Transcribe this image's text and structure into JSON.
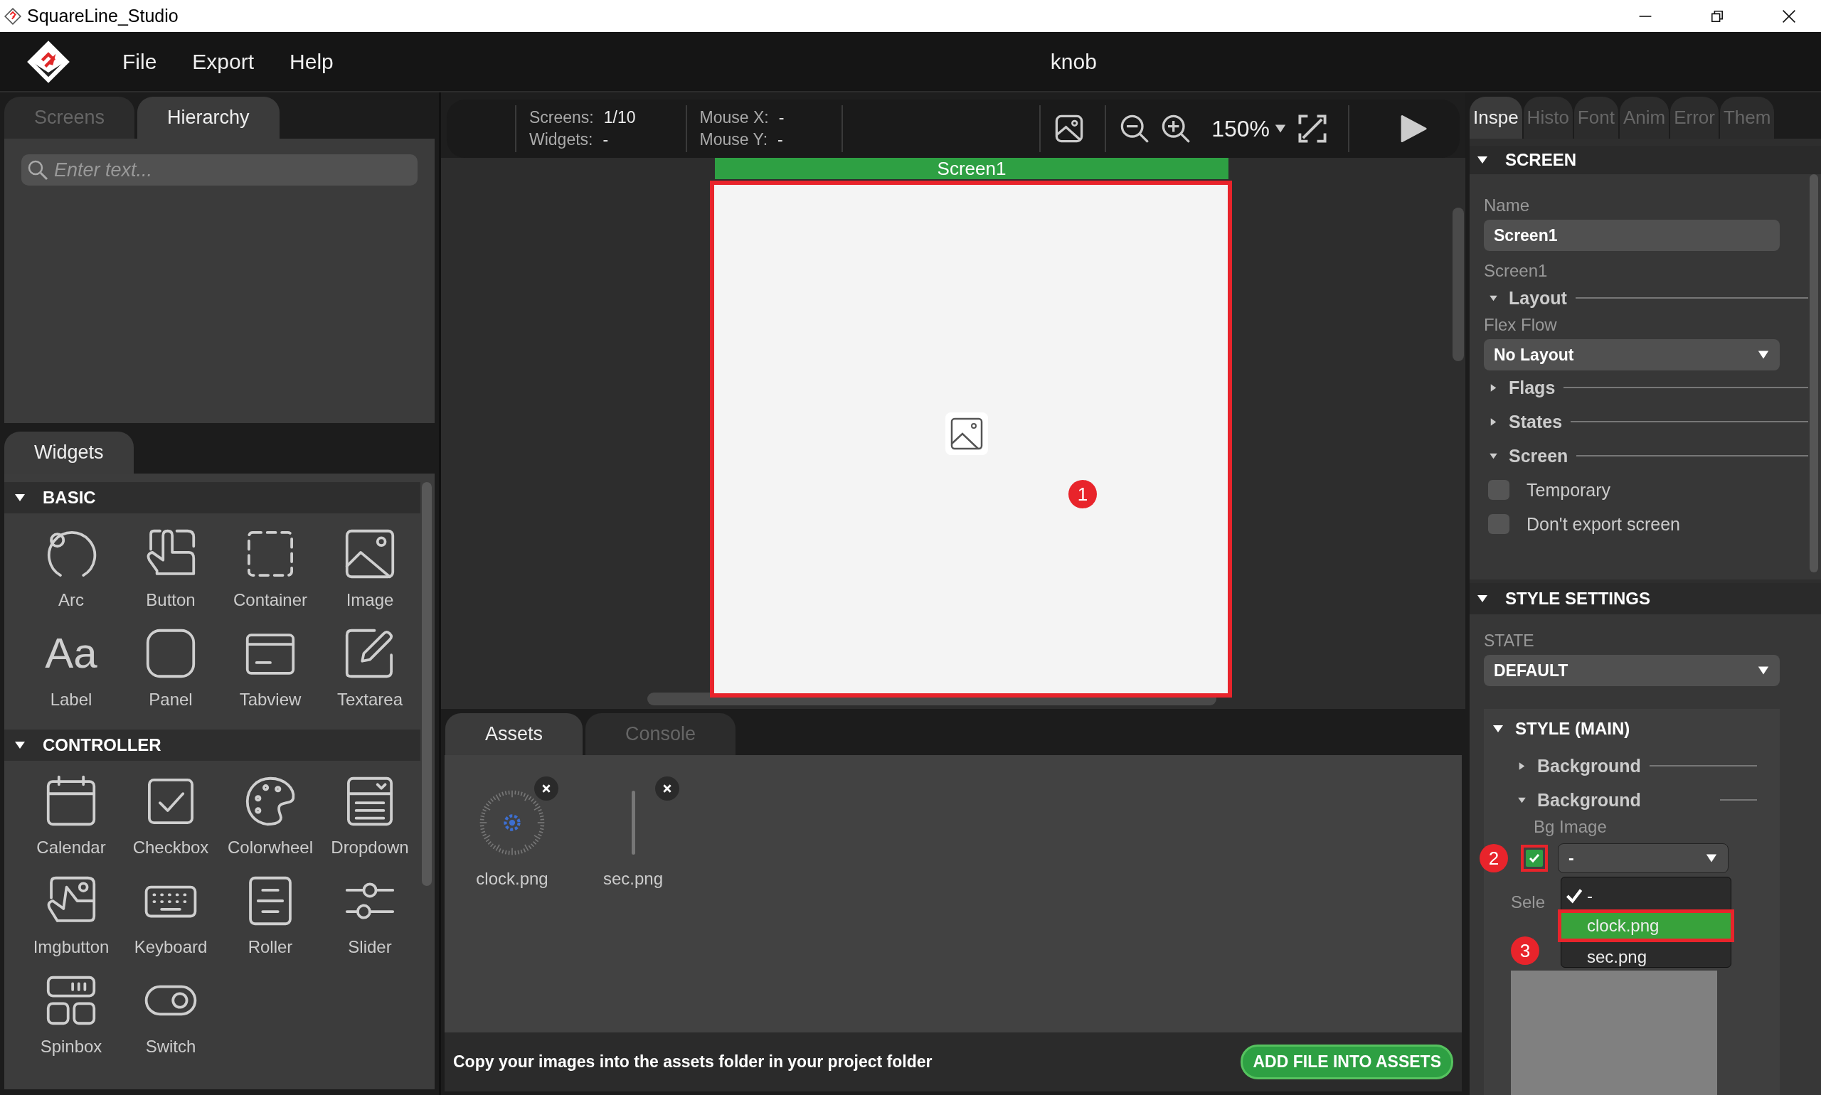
{
  "window": {
    "title": "SquareLine_Studio"
  },
  "menu": [
    "File",
    "Export",
    "Help"
  ],
  "project_title": "knob",
  "left_tabs": [
    {
      "label": "Screens",
      "selected": false
    },
    {
      "label": "Hierarchy",
      "selected": true
    }
  ],
  "hierarchy_search": {
    "placeholder": "Enter text..."
  },
  "widgets_tab": {
    "label": "Widgets",
    "selected": true
  },
  "widget_groups": [
    {
      "title": "BASIC",
      "expanded": true,
      "items": [
        {
          "label": "Arc",
          "kind": "arc"
        },
        {
          "label": "Button",
          "kind": "button"
        },
        {
          "label": "Container",
          "kind": "container"
        },
        {
          "label": "Image",
          "kind": "image"
        },
        {
          "label": "Label",
          "kind": "label",
          "glyph": "Aa"
        },
        {
          "label": "Panel",
          "kind": "panel"
        },
        {
          "label": "Tabview",
          "kind": "tabview"
        },
        {
          "label": "Textarea",
          "kind": "textarea"
        }
      ]
    },
    {
      "title": "CONTROLLER",
      "expanded": true,
      "items": [
        {
          "label": "Calendar",
          "kind": "calendar"
        },
        {
          "label": "Checkbox",
          "kind": "checkbox"
        },
        {
          "label": "Colorwheel",
          "kind": "colorwheel"
        },
        {
          "label": "Dropdown",
          "kind": "dropdown"
        },
        {
          "label": "Imgbutton",
          "kind": "imgbutton"
        },
        {
          "label": "Keyboard",
          "kind": "keyboard"
        },
        {
          "label": "Roller",
          "kind": "roller"
        },
        {
          "label": "Slider",
          "kind": "slider"
        },
        {
          "label": "Spinbox",
          "kind": "spinbox"
        },
        {
          "label": "Switch",
          "kind": "switch"
        }
      ]
    }
  ],
  "toolbar": {
    "screens_label": "Screens:",
    "screens_value": "1/10",
    "widgets_label": "Widgets:",
    "widgets_value": "-",
    "mouse_x_label": "Mouse X:",
    "mouse_x_value": "-",
    "mouse_y_label": "Mouse Y:",
    "mouse_y_value": "-",
    "zoom": "150%"
  },
  "canvas": {
    "screen_title": "Screen1"
  },
  "annotations": [
    "1",
    "2",
    "3"
  ],
  "bottom_tabs": [
    {
      "label": "Assets",
      "selected": true
    },
    {
      "label": "Console",
      "selected": false
    }
  ],
  "assets": [
    {
      "name": "clock.png",
      "kind": "clock"
    },
    {
      "name": "sec.png",
      "kind": "hand"
    }
  ],
  "assets_hint": "Copy your images into the assets folder in your project folder",
  "add_button": "ADD FILE INTO ASSETS",
  "right_tabs": [
    {
      "label": "Inspe",
      "selected": true
    },
    {
      "label": "Histo",
      "selected": false
    },
    {
      "label": "Font",
      "selected": false
    },
    {
      "label": "Anim",
      "selected": false
    },
    {
      "label": "Error",
      "selected": false
    },
    {
      "label": "Them",
      "selected": false
    }
  ],
  "inspector": {
    "title": "SCREEN",
    "expanded": true,
    "name_label": "Name",
    "name_value": "Screen1",
    "object_type": "Screen1",
    "layout": {
      "title": "Layout",
      "expanded": true
    },
    "flex_flow_label": "Flex Flow",
    "flex_flow_value": "No Layout",
    "groups": [
      {
        "title": "Flags",
        "expanded": false
      },
      {
        "title": "States",
        "expanded": false
      },
      {
        "title": "Screen",
        "expanded": true
      }
    ],
    "options": [
      {
        "label": "Temporary",
        "checked": false
      },
      {
        "label": "Don't export screen",
        "checked": false
      }
    ]
  },
  "style_settings": {
    "title": "STYLE SETTINGS",
    "expanded": true,
    "state_label": "STATE",
    "state_value": "DEFAULT",
    "style_title": "STYLE (MAIN)",
    "style_expanded": true,
    "groups": [
      {
        "title": "Background",
        "expanded": false
      },
      {
        "title": "Background",
        "expanded": true
      }
    ],
    "bg_image_label": "Bg Image",
    "bg_image_enabled": true,
    "bg_image_value": "-",
    "covered_label": "Sele",
    "dropdown_options": [
      {
        "label": "-",
        "checked": true,
        "highlighted": false
      },
      {
        "label": "clock.png",
        "checked": false,
        "highlighted": true
      },
      {
        "label": "sec.png",
        "checked": false,
        "highlighted": false
      }
    ]
  }
}
